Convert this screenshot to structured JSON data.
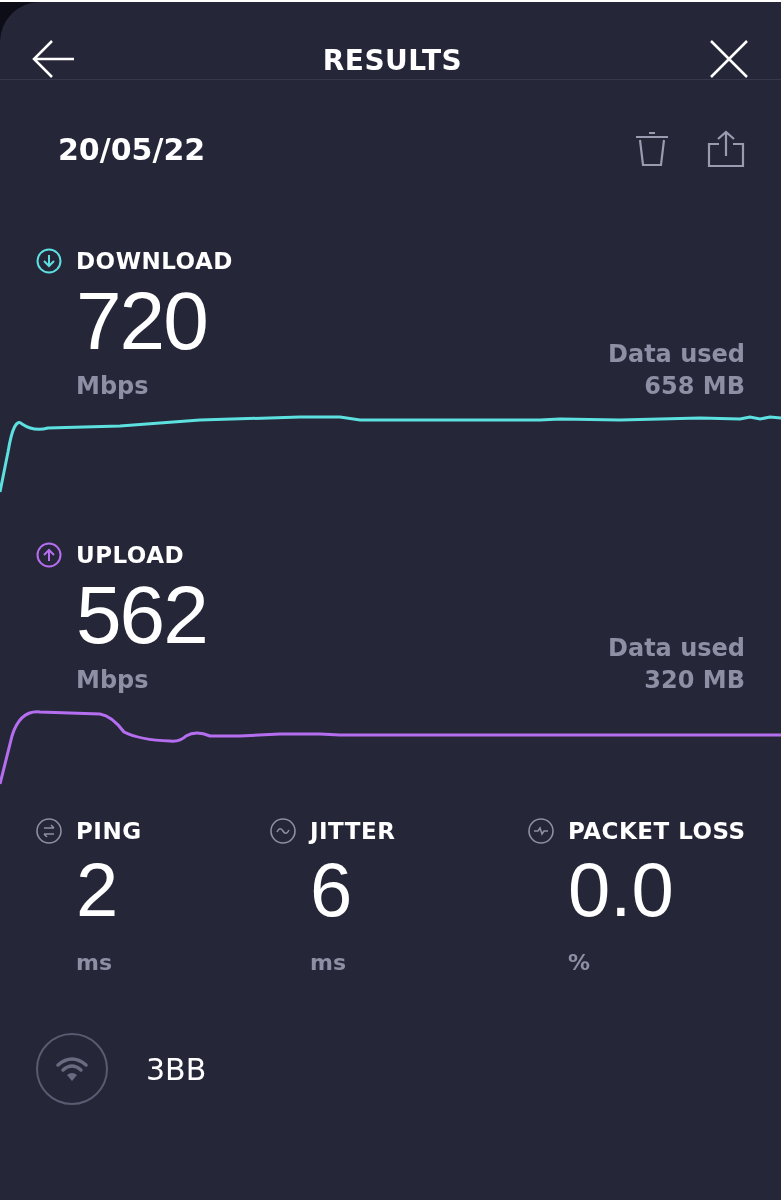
{
  "header": {
    "title": "RESULTS"
  },
  "date": "20/05/22",
  "metrics": [
    {
      "kind": "download",
      "label": "DOWNLOAD",
      "value": "720",
      "unit": "Mbps",
      "data_label": "Data used",
      "data_value": "658 MB",
      "color": "#5ce1e0"
    },
    {
      "kind": "upload",
      "label": "UPLOAD",
      "value": "562",
      "unit": "Mbps",
      "data_label": "Data used",
      "data_value": "320 MB",
      "color": "#b66ef0"
    }
  ],
  "stats": [
    {
      "kind": "ping",
      "label": "PING",
      "value": "2",
      "unit": "ms"
    },
    {
      "kind": "jitter",
      "label": "JITTER",
      "value": "6",
      "unit": "ms"
    },
    {
      "kind": "packet_loss",
      "label": "PACKET LOSS",
      "value": "0.0",
      "unit": "%"
    }
  ],
  "network": {
    "name": "3BB"
  }
}
